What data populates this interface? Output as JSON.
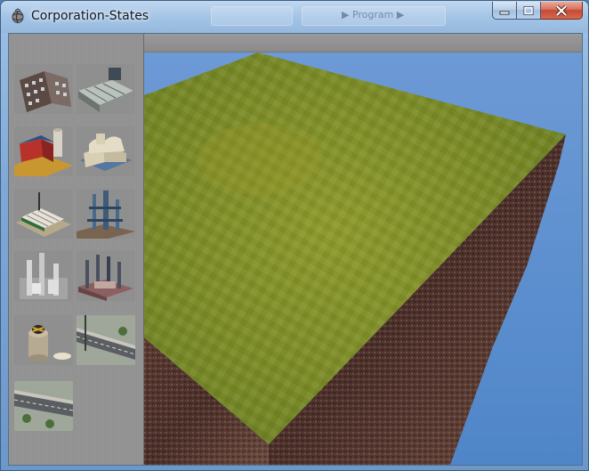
{
  "window": {
    "title": "Corporation-States",
    "app_icon": "app-globe-icon",
    "controls": {
      "minimize_icon": "minimize-icon",
      "maximize_icon": "maximize-icon",
      "close_icon": "close-icon"
    },
    "background_window_text": "▶ Program ▶"
  },
  "palette": {
    "items": [
      {
        "name": "apartment-buildings",
        "icon": "apartment-building-icon"
      },
      {
        "name": "office-blocks",
        "icon": "office-block-icon"
      },
      {
        "name": "red-barn-farm",
        "icon": "barn-silo-icon"
      },
      {
        "name": "storage-warehouse",
        "icon": "warehouse-icon"
      },
      {
        "name": "factory-with-crane",
        "icon": "factory-icon"
      },
      {
        "name": "refinery-towers",
        "icon": "refinery-icon"
      },
      {
        "name": "power-plant-stacks",
        "icon": "power-plant-icon"
      },
      {
        "name": "industrial-smokestacks",
        "icon": "smokestack-icon"
      },
      {
        "name": "water-tank",
        "icon": "water-tank-icon"
      },
      {
        "name": "road-section",
        "icon": "road-icon"
      },
      {
        "name": "road-section-2",
        "icon": "road-icon"
      }
    ]
  },
  "scene": {
    "sky_color": "#5b8fd0",
    "grass_color": "#7d8f2a",
    "soil_color": "#5a3a30"
  }
}
